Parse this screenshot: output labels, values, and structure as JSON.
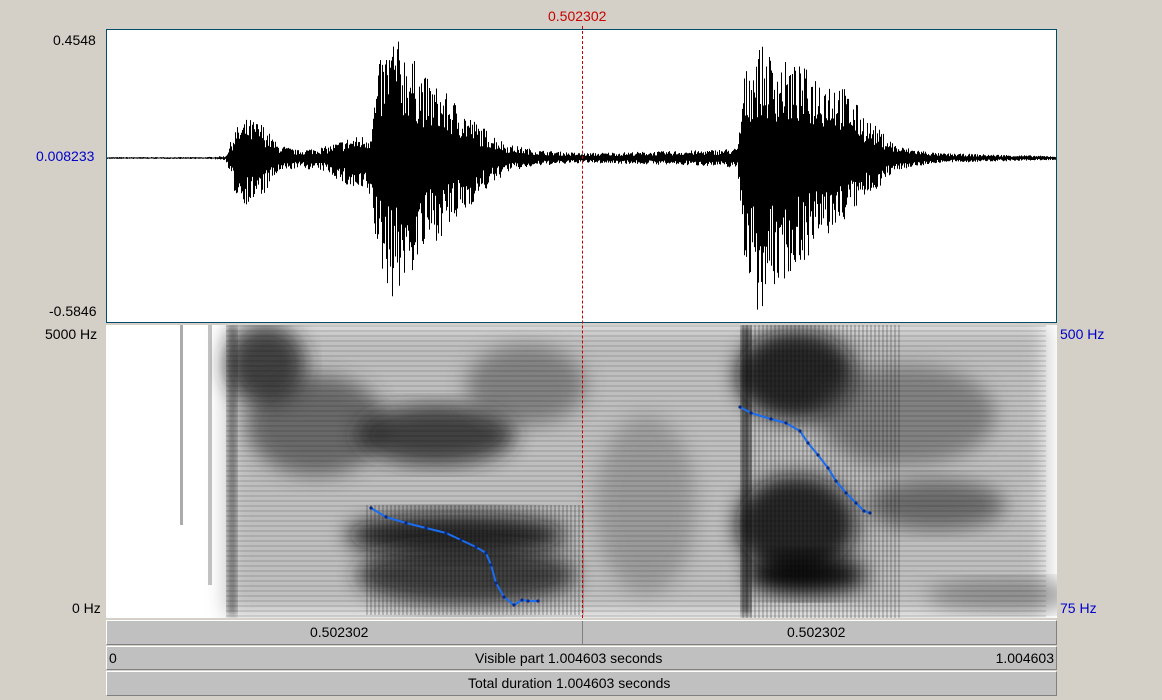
{
  "cursor": {
    "time_label": "0.502302"
  },
  "waveform": {
    "y_max": "0.4548",
    "y_zero": "0.008233",
    "y_min": "-0.5846"
  },
  "spectrogram": {
    "freq_top": "5000 Hz",
    "freq_bottom": "0 Hz",
    "pitch_top": "500 Hz",
    "pitch_bottom": "75 Hz"
  },
  "selection_bar": {
    "left_segment": "0.502302",
    "right_segment": "0.502302"
  },
  "visible_bar": {
    "start": "0",
    "label": "Visible part 1.004603 seconds",
    "end": "1.004603"
  },
  "total_bar": {
    "label": "Total duration 1.004603 seconds"
  },
  "colors": {
    "cursor": "#c80000",
    "pitch": "#1a6cf0",
    "axis_blue": "#0000c8"
  }
}
